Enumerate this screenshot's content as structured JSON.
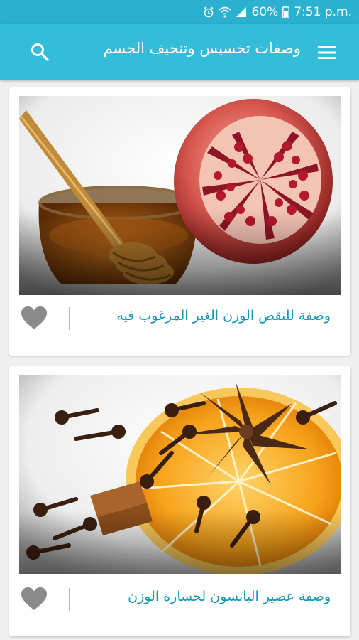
{
  "status_bar": {
    "battery": "60%",
    "time": "7:51 p.m."
  },
  "app_bar": {
    "title": "وصفات تخسيس وتنحيف الجسم",
    "menu_icon": "hamburger-menu-icon",
    "search_icon": "search-icon"
  },
  "cards": [
    {
      "caption": "وصفة للنقص الوزن الغير المرغوب فيه",
      "image": "honey-and-pomegranate-photo",
      "favorite_icon": "heart-icon"
    },
    {
      "caption": "وصفة عصير اليانسون لخسارة الوزن",
      "image": "orange-star-anise-cloves-photo",
      "favorite_icon": "heart-icon"
    }
  ],
  "colors": {
    "status_bar": "#2bb1cf",
    "app_bar": "#34bdd8",
    "caption": "#1597b5",
    "heart": "#8a8a8a",
    "background": "#f0f0f0"
  }
}
